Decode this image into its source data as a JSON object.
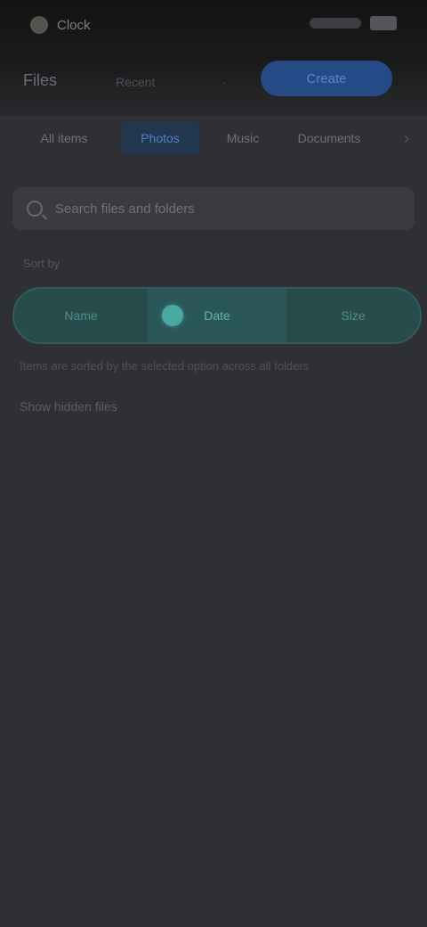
{
  "status_bar": {
    "app_label": "Clock",
    "status_right": "Battery"
  },
  "header": {
    "title": "Files",
    "subtitle": "Recent",
    "separator": "·",
    "primary_button": "Create"
  },
  "tabs": [
    {
      "label": "All items",
      "active": false
    },
    {
      "label": "Photos",
      "active": true
    },
    {
      "label": "Music",
      "active": false
    },
    {
      "label": "Documents",
      "active": false
    }
  ],
  "tabs_more": "›",
  "search": {
    "placeholder": "Search files and folders",
    "value": ""
  },
  "section_label": "Sort by",
  "selector": {
    "options": [
      {
        "label": "Name",
        "active": false
      },
      {
        "label": "Date",
        "active": true
      },
      {
        "label": "Size",
        "active": false
      }
    ]
  },
  "helper_text": "Items are sorted by the selected option across all folders",
  "link_text": "Show hidden files"
}
